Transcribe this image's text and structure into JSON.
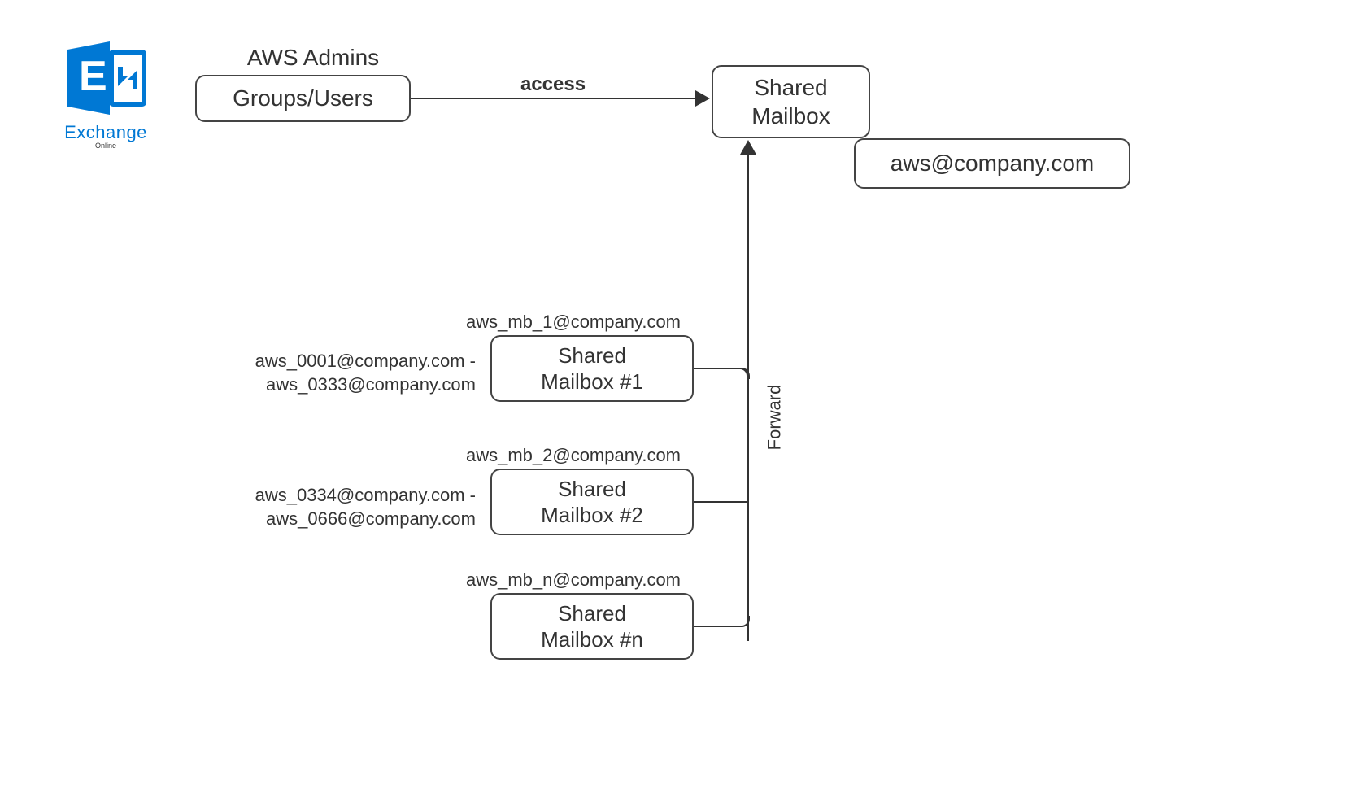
{
  "logo": {
    "name": "Exchange",
    "sub": "Online"
  },
  "admins": {
    "title": "AWS Admins",
    "box": "Groups/Users"
  },
  "access_label": "access",
  "shared_main": {
    "label": "Shared\nMailbox",
    "address": "aws@company.com"
  },
  "forward_label": "Forward",
  "mailboxes": [
    {
      "addr": "aws_mb_1@company.com",
      "name": "Shared\nMailbox #1",
      "range": "aws_0001@company.com -\naws_0333@company.com"
    },
    {
      "addr": "aws_mb_2@company.com",
      "name": "Shared\nMailbox #2",
      "range": "aws_0334@company.com -\naws_0666@company.com"
    },
    {
      "addr": "aws_mb_n@company.com",
      "name": "Shared\nMailbox #n",
      "range": ""
    }
  ]
}
